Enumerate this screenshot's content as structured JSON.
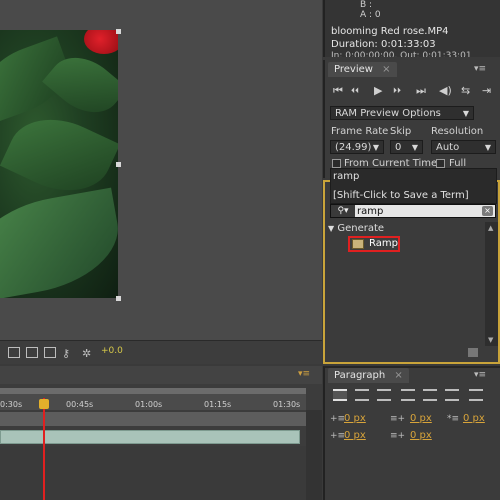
{
  "info": {
    "line_b": "B :",
    "line_a": "A : 0",
    "clip_name": "blooming Red rose.MP4",
    "clip_duration": "Duration: 0:01:33:03",
    "clip_inout": "In: 0:00:00:00, Out: 0:01:33:01"
  },
  "viewer": {
    "offset_value": "+0.0"
  },
  "timeline": {
    "ticks": [
      "0:30s",
      "00:45s",
      "01:00s",
      "01:15s",
      "01:30s"
    ]
  },
  "preview": {
    "tab_label": "Preview",
    "close_glyph": "×",
    "controls": [
      "⏮",
      "⏴⏴",
      "▶",
      "⏵⏵",
      "⏭",
      "⇆",
      "⇥"
    ],
    "ram_preview_options": "RAM Preview Options",
    "frame_rate_label": "Frame Rate",
    "frame_rate_value": "(24.99)",
    "skip_label": "Skip",
    "skip_value": "0",
    "resolution_label": "Resolution",
    "resolution_value": "Auto",
    "from_current_time": "From Current Time",
    "full_screen": "Full Screen"
  },
  "effects": {
    "recent_term": "ramp",
    "hint": "[Shift-Click to Save a Term]",
    "search_value": "ramp",
    "category": "Generate",
    "item": "Ramp",
    "clear_glyph": "×"
  },
  "paragraph": {
    "tab_label": "Paragraph",
    "close_glyph": "×",
    "values": [
      "0 px",
      "0 px",
      "0 px",
      "0 px",
      "0 px"
    ]
  },
  "colors": {
    "accent_border": "#c9a43a",
    "highlight_red": "#e02020",
    "playhead": "#e02020",
    "value_orange": "#d8a43a"
  }
}
